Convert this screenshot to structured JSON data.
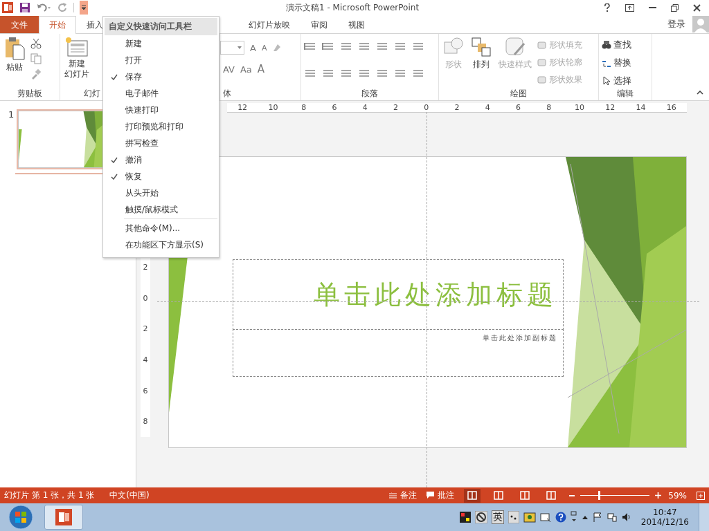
{
  "window": {
    "title": "演示文稿1 - Microsoft PowerPoint",
    "qat_expanded": true
  },
  "tabs": [
    {
      "label": "文件",
      "kind": "file",
      "selected": false
    },
    {
      "label": "开始",
      "kind": "tab",
      "selected": true
    },
    {
      "label": "插入",
      "kind": "tab",
      "selected": false
    },
    {
      "label": "幻灯片放映",
      "kind": "tab",
      "selected": false
    },
    {
      "label": "审阅",
      "kind": "tab",
      "selected": false
    },
    {
      "label": "视图",
      "kind": "tab",
      "selected": false
    }
  ],
  "account": "登录",
  "ribbon": {
    "clipboard": {
      "paste": "粘贴",
      "label": "剪贴板"
    },
    "slides": {
      "new_slide": "新建",
      "new_slide_2": "幻灯片",
      "label": "幻灯"
    },
    "font": {
      "label": "体",
      "tools": [
        "A",
        "A",
        "AV",
        "Aa",
        "A"
      ]
    },
    "paragraph": {
      "label": "段落"
    },
    "drawing": {
      "label": "绘图",
      "large": [
        {
          "label": "形状",
          "disabled": true
        },
        {
          "label": "排列",
          "disabled": false
        },
        {
          "label": "快速样式",
          "disabled": true
        }
      ],
      "format": [
        {
          "label": "形状填充",
          "disabled": true
        },
        {
          "label": "形状轮廓",
          "disabled": true
        },
        {
          "label": "形状效果",
          "disabled": true
        }
      ]
    },
    "editing": {
      "label": "编辑",
      "items": [
        "查找",
        "替换",
        "选择"
      ]
    }
  },
  "qat_menu": {
    "title": "自定义快速访问工具栏",
    "items": [
      {
        "label": "新建",
        "checked": false
      },
      {
        "label": "打开",
        "checked": false
      },
      {
        "label": "保存",
        "checked": true
      },
      {
        "label": "电子邮件",
        "checked": false
      },
      {
        "label": "快速打印",
        "checked": false
      },
      {
        "label": "打印预览和打印",
        "checked": false
      },
      {
        "label": "拼写检查",
        "checked": false
      },
      {
        "label": "撤消",
        "checked": true
      },
      {
        "label": "恢复",
        "checked": true
      },
      {
        "label": "从头开始",
        "checked": false
      },
      {
        "label": "触摸/鼠标模式",
        "checked": false
      }
    ],
    "more": [
      "其他命令(M)...",
      "在功能区下方显示(S)"
    ]
  },
  "thumbnails": [
    {
      "number": "1",
      "selected": true
    }
  ],
  "rulers": {
    "horizontal": [
      "12",
      "10",
      "8",
      "6",
      "4",
      "2",
      "0",
      "2",
      "4",
      "6",
      "8",
      "10",
      "12",
      "14",
      "16"
    ],
    "vertical": [
      "2",
      "0",
      "2",
      "4",
      "6",
      "8"
    ]
  },
  "slide": {
    "title": "单击此处添加标题",
    "subtitle": "单击此处添加副标题"
  },
  "status_bar": {
    "slide_info": "幻灯片 第 1 张，共 1 张",
    "language": "中文(中国)",
    "notes": "备注",
    "comments": "批注",
    "views": [
      {
        "selected": true
      },
      {
        "selected": false
      },
      {
        "selected": false
      },
      {
        "selected": false
      }
    ],
    "zoom_slider": {
      "level": 0.26
    },
    "zoom": "59%"
  },
  "taskbar": {
    "ime": "英",
    "time": "10:47",
    "date": "2014/12/16"
  }
}
